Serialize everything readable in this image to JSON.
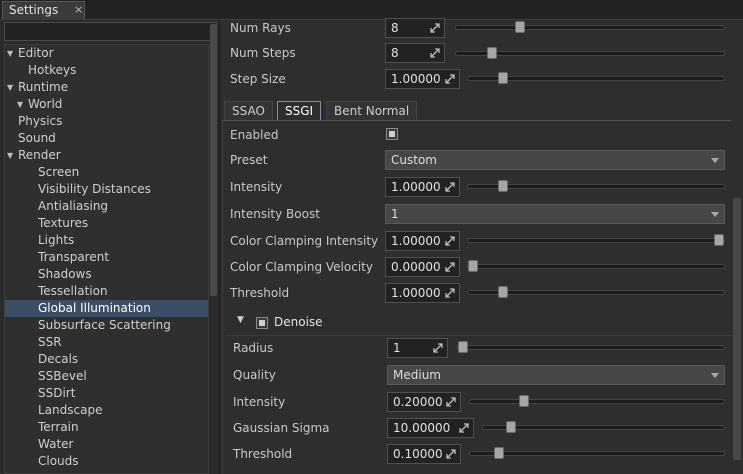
{
  "window": {
    "tab_title": "Settings",
    "close_glyph": "×"
  },
  "search": {
    "placeholder": "",
    "value": ""
  },
  "tree": [
    {
      "label": "Editor",
      "arrow": "▼",
      "level": 0
    },
    {
      "label": "Hotkeys",
      "arrow": "",
      "level": 1
    },
    {
      "label": "Runtime",
      "arrow": "▼",
      "level": 0
    },
    {
      "label": "World",
      "arrow": "▼",
      "level": 1
    },
    {
      "label": "Physics",
      "arrow": "",
      "level": 2
    },
    {
      "label": "Sound",
      "arrow": "",
      "level": 2
    },
    {
      "label": "Render",
      "arrow": "▼",
      "level": 2
    },
    {
      "label": "Screen",
      "arrow": "",
      "level": 3
    },
    {
      "label": "Visibility Distances",
      "arrow": "",
      "level": 3
    },
    {
      "label": "Antialiasing",
      "arrow": "",
      "level": 3
    },
    {
      "label": "Textures",
      "arrow": "",
      "level": 3
    },
    {
      "label": "Lights",
      "arrow": "",
      "level": 3
    },
    {
      "label": "Transparent",
      "arrow": "",
      "level": 3
    },
    {
      "label": "Shadows",
      "arrow": "",
      "level": 3
    },
    {
      "label": "Tessellation",
      "arrow": "",
      "level": 3
    },
    {
      "label": "Global Illumination",
      "arrow": "",
      "level": 3,
      "selected": true
    },
    {
      "label": "Subsurface Scattering",
      "arrow": "",
      "level": 3
    },
    {
      "label": "SSR",
      "arrow": "",
      "level": 3
    },
    {
      "label": "Decals",
      "arrow": "",
      "level": 3
    },
    {
      "label": "SSBevel",
      "arrow": "",
      "level": 3
    },
    {
      "label": "SSDirt",
      "arrow": "",
      "level": 3
    },
    {
      "label": "Landscape",
      "arrow": "",
      "level": 3
    },
    {
      "label": "Terrain",
      "arrow": "",
      "level": 3
    },
    {
      "label": "Water",
      "arrow": "",
      "level": 3
    },
    {
      "label": "Clouds",
      "arrow": "",
      "level": 3
    }
  ],
  "top_params": {
    "num_rays": {
      "label": "Num Rays",
      "value": "8",
      "slider_fraction": 0.23
    },
    "num_steps": {
      "label": "Num Steps",
      "value": "8",
      "slider_fraction": 0.12
    },
    "step_size": {
      "label": "Step Size",
      "value": "1.00000",
      "slider_fraction": 0.12
    }
  },
  "subtabs": [
    "SSAO",
    "SSGI",
    "Bent Normal"
  ],
  "active_subtab": "SSGI",
  "ssgi": {
    "enabled": {
      "label": "Enabled",
      "checked": true
    },
    "preset": {
      "label": "Preset",
      "value": "Custom"
    },
    "intensity": {
      "label": "Intensity",
      "value": "1.00000",
      "slider_fraction": 0.12
    },
    "intensity_boost": {
      "label": "Intensity Boost",
      "value": "1"
    },
    "color_clamping_intensity": {
      "label": "Color Clamping Intensity",
      "value": "1.00000",
      "slider_fraction": 1.0
    },
    "color_clamping_velocity": {
      "label": "Color Clamping Velocity",
      "value": "0.00000",
      "slider_fraction": 0.0
    },
    "threshold": {
      "label": "Threshold",
      "value": "1.00000",
      "slider_fraction": 0.12
    }
  },
  "denoise": {
    "label": "Denoise",
    "checked": true,
    "radius": {
      "label": "Radius",
      "value": "1",
      "slider_fraction": 0.0
    },
    "quality": {
      "label": "Quality",
      "value": "Medium"
    },
    "intensity": {
      "label": "Intensity",
      "value": "0.20000",
      "slider_fraction": 0.2
    },
    "gaussian_sigma": {
      "label": "Gaussian Sigma",
      "value": "10.00000",
      "slider_fraction": 0.1
    },
    "threshold": {
      "label": "Threshold",
      "value": "0.10000",
      "slider_fraction": 0.1
    }
  },
  "colors": {
    "accent": "#3a4f66",
    "panel": "#2e2e2e",
    "field": "#222222"
  },
  "icons": {
    "expand": "expand-arrows-icon",
    "combo": "chevron-down-icon"
  }
}
